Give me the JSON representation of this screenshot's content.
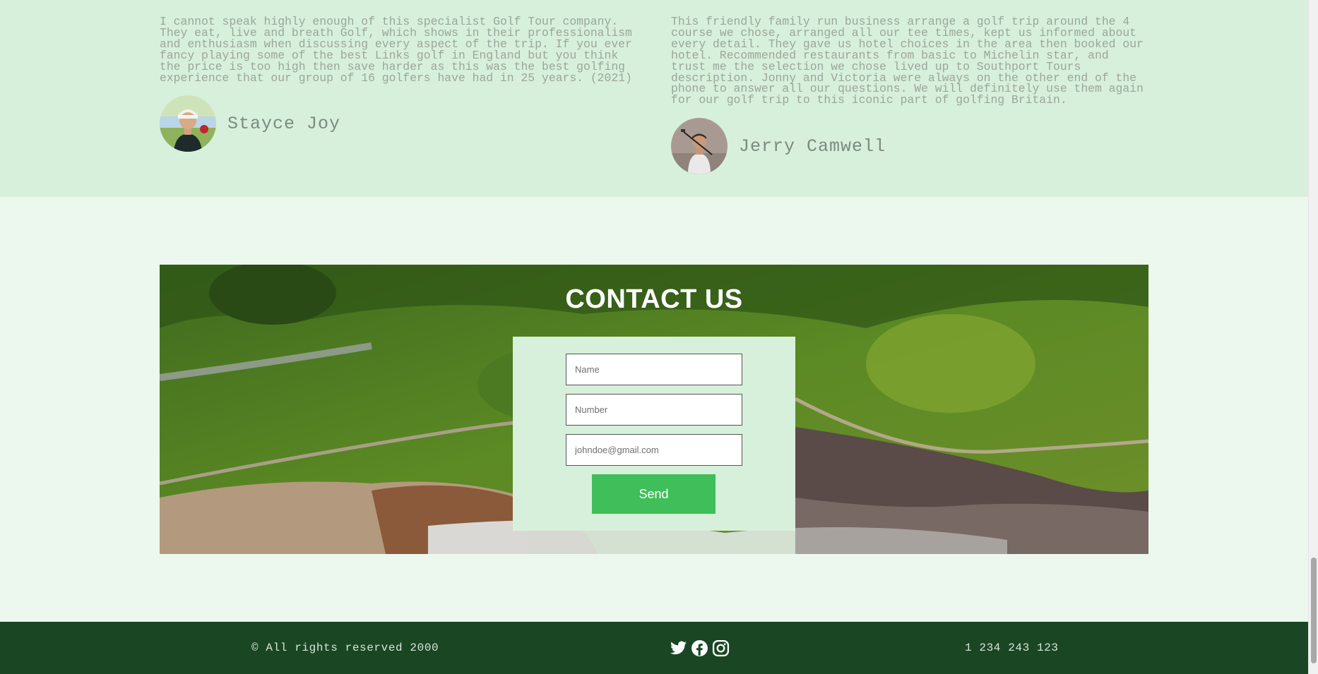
{
  "testimonials": [
    {
      "quote": "I cannot speak highly enough of this specialist Golf Tour company.\nThey eat, live and breath Golf, which shows in their professionalism\nand enthusiasm when discussing every aspect of the trip. If you ever\nfancy playing some of the best Links golf in England but you think\nthe price is too high then save harder as this was the best golfing\nexperience that our group of 16 golfers have had in 25 years. (2021)",
      "name": "Stayce Joy"
    },
    {
      "quote": "This friendly family run business arrange a golf trip around the 4\ncourse we chose, arranged all our tee times, kept us informed about\nevery detail. They gave us hotel choices in the area then booked our\nhotel. Recommended restaurants from basic to Michelin star, and\ntrust me the selection we chose lived up to Southport Tours\ndescription. Jonny and Victoria were always on the other end of the\nphone to answer all our questions. We will definitely use them again\nfor our golf trip to this iconic part of golfing Britain.",
      "name": "Jerry Camwell"
    }
  ],
  "contact": {
    "title": "CONTACT US",
    "name_placeholder": "Name",
    "number_placeholder": "Number",
    "email_placeholder": "johndoe@gmail.com",
    "send_label": "Send"
  },
  "footer": {
    "copyright": "© All rights reserved 2000",
    "phone": "1 234 243 123",
    "social_icons": [
      "twitter-icon",
      "facebook-icon",
      "instagram-icon"
    ]
  },
  "colors": {
    "testimonial_bg": "#d7f0db",
    "page_bg": "#ecf8ee",
    "footer_bg": "#1a4623",
    "send_button": "#3fbe59"
  }
}
